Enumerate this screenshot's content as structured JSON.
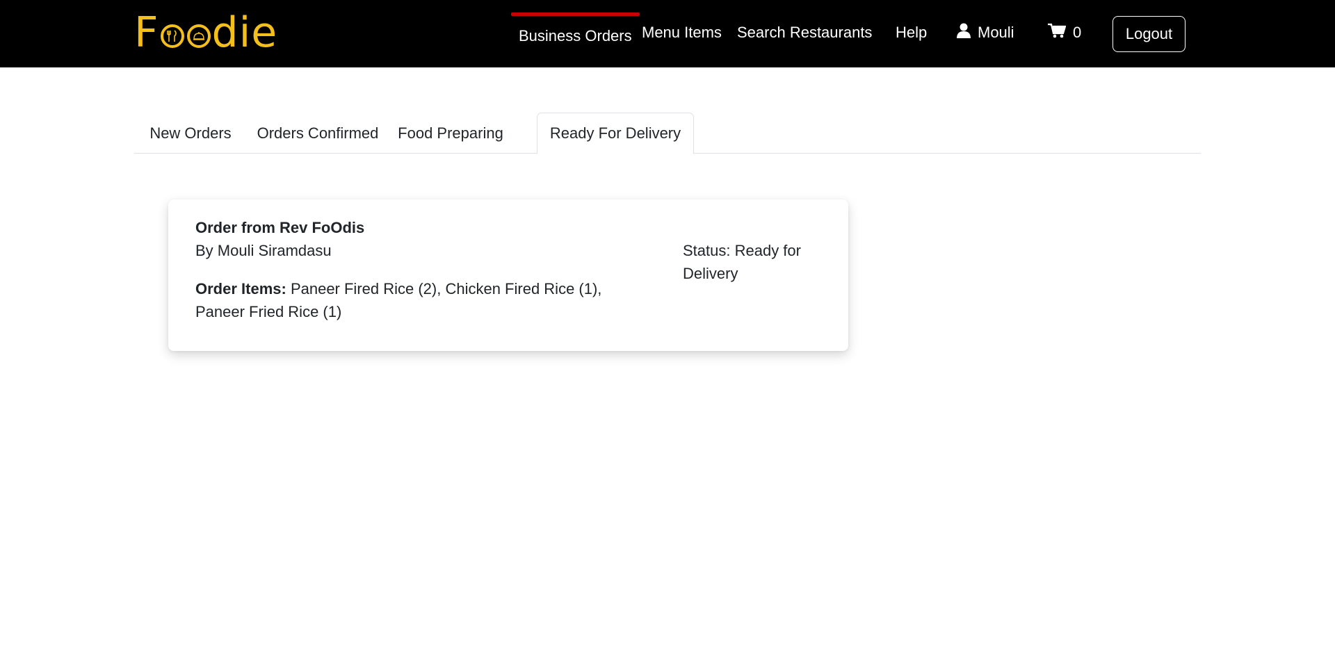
{
  "brand": {
    "logo_start": "F",
    "logo_end": "die",
    "logo_color": "#f5bf1b"
  },
  "nav": {
    "business_orders": "Business Orders",
    "menu_items": "Menu Items",
    "search_restaurants": "Search Restaurants",
    "help": "Help",
    "user_name": "Mouli",
    "cart_count": "0",
    "logout": "Logout",
    "active_indicator_color": "#cc0000"
  },
  "tabs": [
    {
      "label": "New Orders",
      "active": false
    },
    {
      "label": "Orders Confirmed",
      "active": false
    },
    {
      "label": "Food Preparing",
      "active": false
    },
    {
      "label": "Ready For Delivery",
      "active": true
    }
  ],
  "order": {
    "title": "Order from Rev FoOdis",
    "by": "By Mouli Siramdasu",
    "items_label": "Order Items:",
    "items": " Paneer Fired Rice (2), Chicken Fired Rice (1), Paneer Fried Rice (1)",
    "status": "Status: Ready for Delivery"
  }
}
